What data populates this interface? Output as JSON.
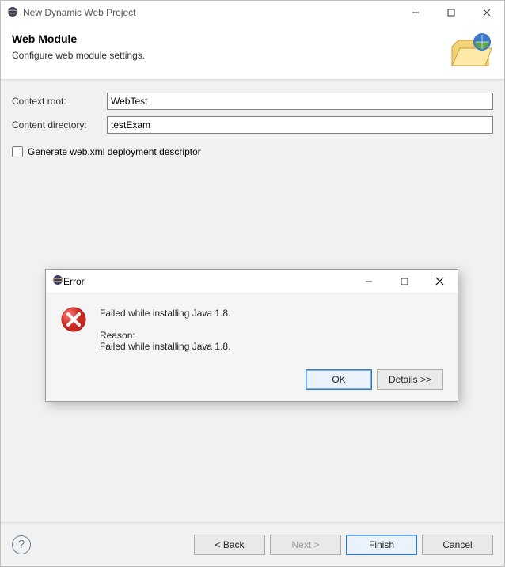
{
  "window": {
    "title": "New Dynamic Web Project",
    "minimize_name": "minimize-icon",
    "maximize_name": "maximize-icon",
    "close_name": "close-icon"
  },
  "banner": {
    "heading": "Web Module",
    "sub": "Configure web module settings."
  },
  "form": {
    "context_root_label": "Context root:",
    "context_root_value": "WebTest",
    "content_dir_label": "Content directory:",
    "content_dir_value": "testExam",
    "gen_webxml_label": "Generate web.xml deployment descriptor",
    "gen_webxml_checked": false
  },
  "footer": {
    "back": "< Back",
    "next": "Next >",
    "finish": "Finish",
    "cancel": "Cancel"
  },
  "error_dialog": {
    "title": "Error",
    "message": "Failed while installing Java 1.8.",
    "reason_label": "Reason:",
    "reason": "Failed while installing Java 1.8.",
    "ok": "OK",
    "details": "Details >>"
  }
}
